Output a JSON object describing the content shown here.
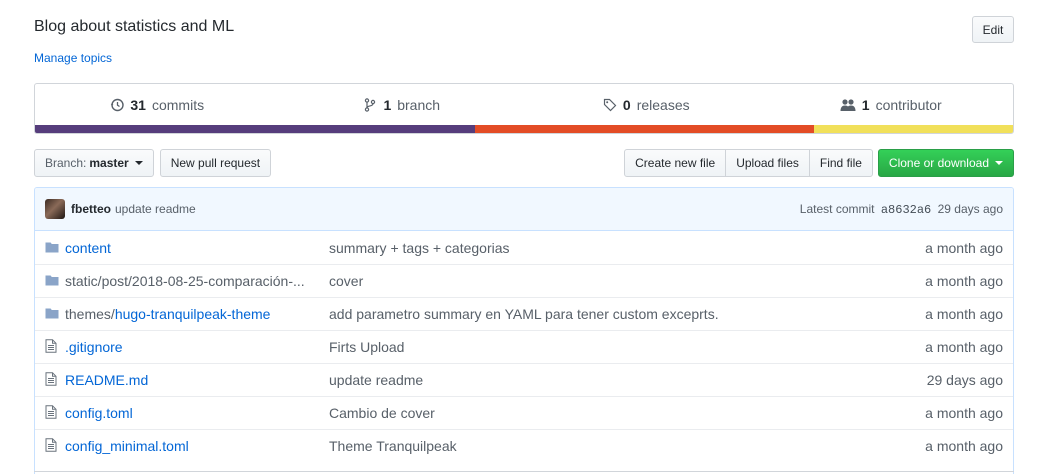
{
  "repo": {
    "description": "Blog about statistics and ML",
    "manage_topics": "Manage topics",
    "edit_label": "Edit"
  },
  "summary": {
    "commits": {
      "count": "31",
      "label": "commits",
      "icon": "history-icon"
    },
    "branches": {
      "count": "1",
      "label": "branch",
      "icon": "git-branch-icon"
    },
    "releases": {
      "count": "0",
      "label": "releases",
      "icon": "tag-icon"
    },
    "contributors": {
      "count": "1",
      "label": "contributor",
      "icon": "people-icon"
    },
    "language_bar": [
      {
        "color": "#563d7c",
        "percent": 45
      },
      {
        "color": "#e34c26",
        "percent": 34.7
      },
      {
        "color": "#f1e05a",
        "percent": 20.3
      }
    ]
  },
  "toolbar": {
    "branch_label": "Branch:",
    "branch_value": "master",
    "new_pr": "New pull request",
    "create_file": "Create new file",
    "upload_files": "Upload files",
    "find_file": "Find file",
    "clone": "Clone or download",
    "clone_color": "#28a745"
  },
  "latest_commit": {
    "author": "fbetteo",
    "message": "update readme",
    "prefix": "Latest commit",
    "sha": "a8632a6",
    "age": "29 days ago"
  },
  "files": [
    {
      "type": "dir",
      "prefix": "",
      "name": "content",
      "message": "summary + tags + categorias",
      "age": "a month ago"
    },
    {
      "type": "dir",
      "prefix": "static/post/2018-08-25-comparación-...",
      "name": "",
      "message": "cover",
      "age": "a month ago"
    },
    {
      "type": "dir",
      "prefix": "themes/",
      "name": "hugo-tranquilpeak-theme",
      "message": "add parametro summary en YAML para tener custom exceprts.",
      "age": "a month ago"
    },
    {
      "type": "file",
      "prefix": "",
      "name": ".gitignore",
      "message": "Firts Upload",
      "age": "a month ago"
    },
    {
      "type": "file",
      "prefix": "",
      "name": "README.md",
      "message": "update readme",
      "age": "29 days ago"
    },
    {
      "type": "file",
      "prefix": "",
      "name": "config.toml",
      "message": "Cambio de cover",
      "age": "a month ago"
    },
    {
      "type": "file",
      "prefix": "",
      "name": "config_minimal.toml",
      "message": "Theme Tranquilpeak",
      "age": "a month ago"
    }
  ]
}
